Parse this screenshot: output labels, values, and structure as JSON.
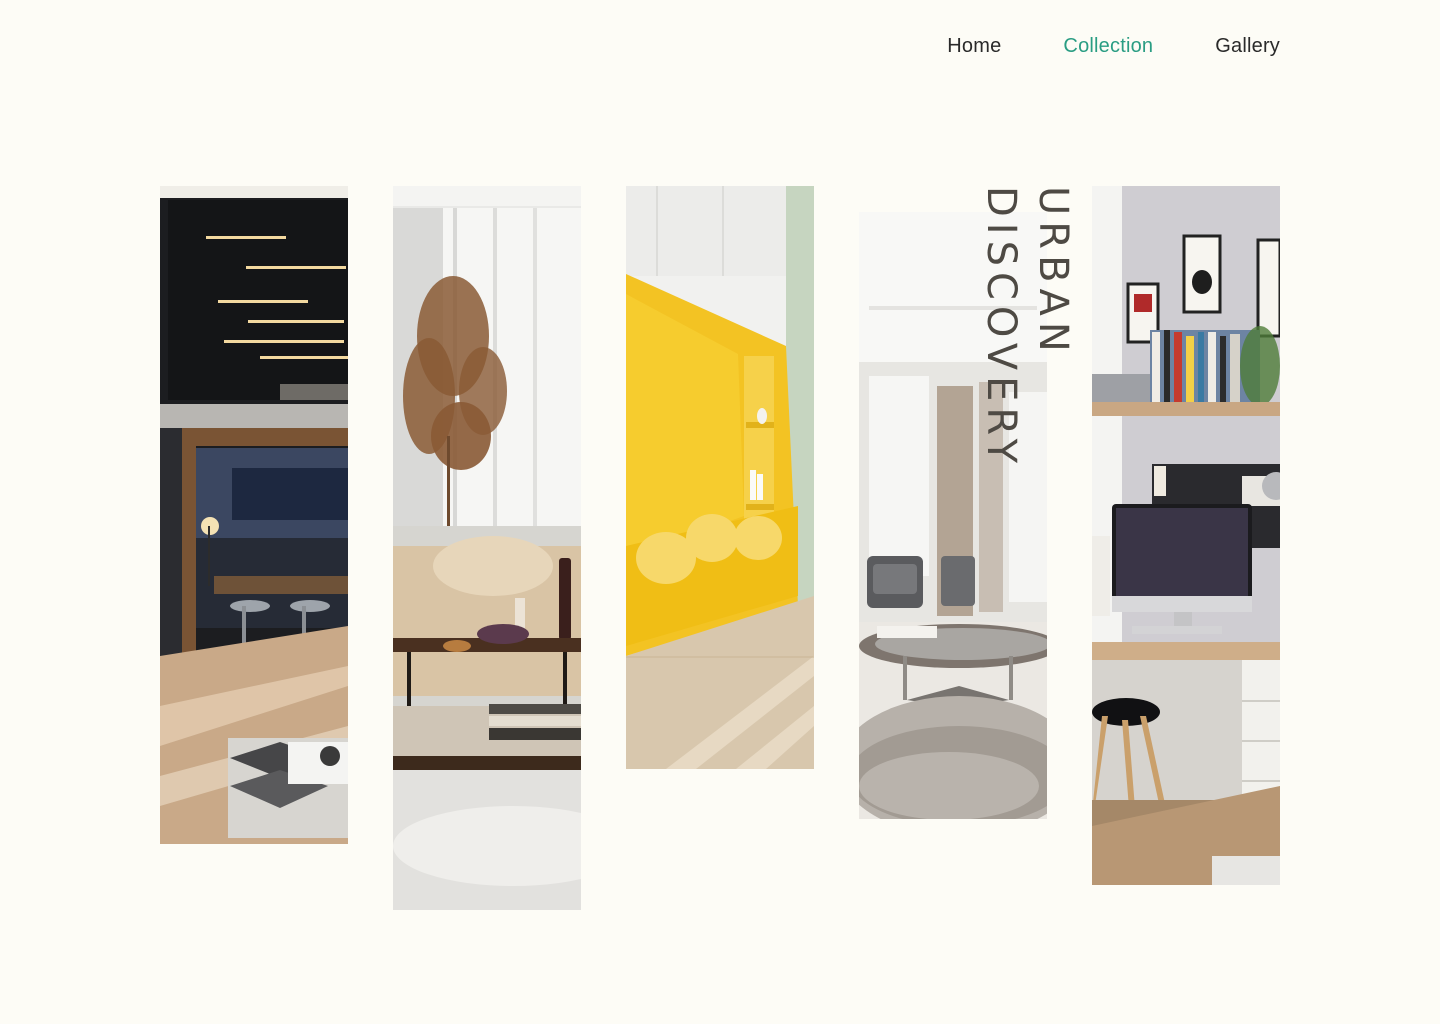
{
  "nav": {
    "items": [
      {
        "label": "Home",
        "active": false
      },
      {
        "label": "Collection",
        "active": true
      },
      {
        "label": "Gallery",
        "active": false
      }
    ],
    "active_color": "#2a9d83"
  },
  "hero": {
    "title_line1": "URBAN",
    "title_line2": "DISCOVERY"
  },
  "panels": [
    {
      "subject": "dark modern loft with dining table and pendant lights"
    },
    {
      "subject": "living room with pampas grass, sofa and coffee table"
    },
    {
      "subject": "bright yellow built-in window seat nook"
    },
    {
      "subject": "airy lounge with grey armchair and round glass table"
    },
    {
      "subject": "home office desk with monitor, shelves and black chair"
    }
  ],
  "colors": {
    "background": "#fdfcf6",
    "text": "#2a2a2a",
    "title": "#4e4a44"
  }
}
